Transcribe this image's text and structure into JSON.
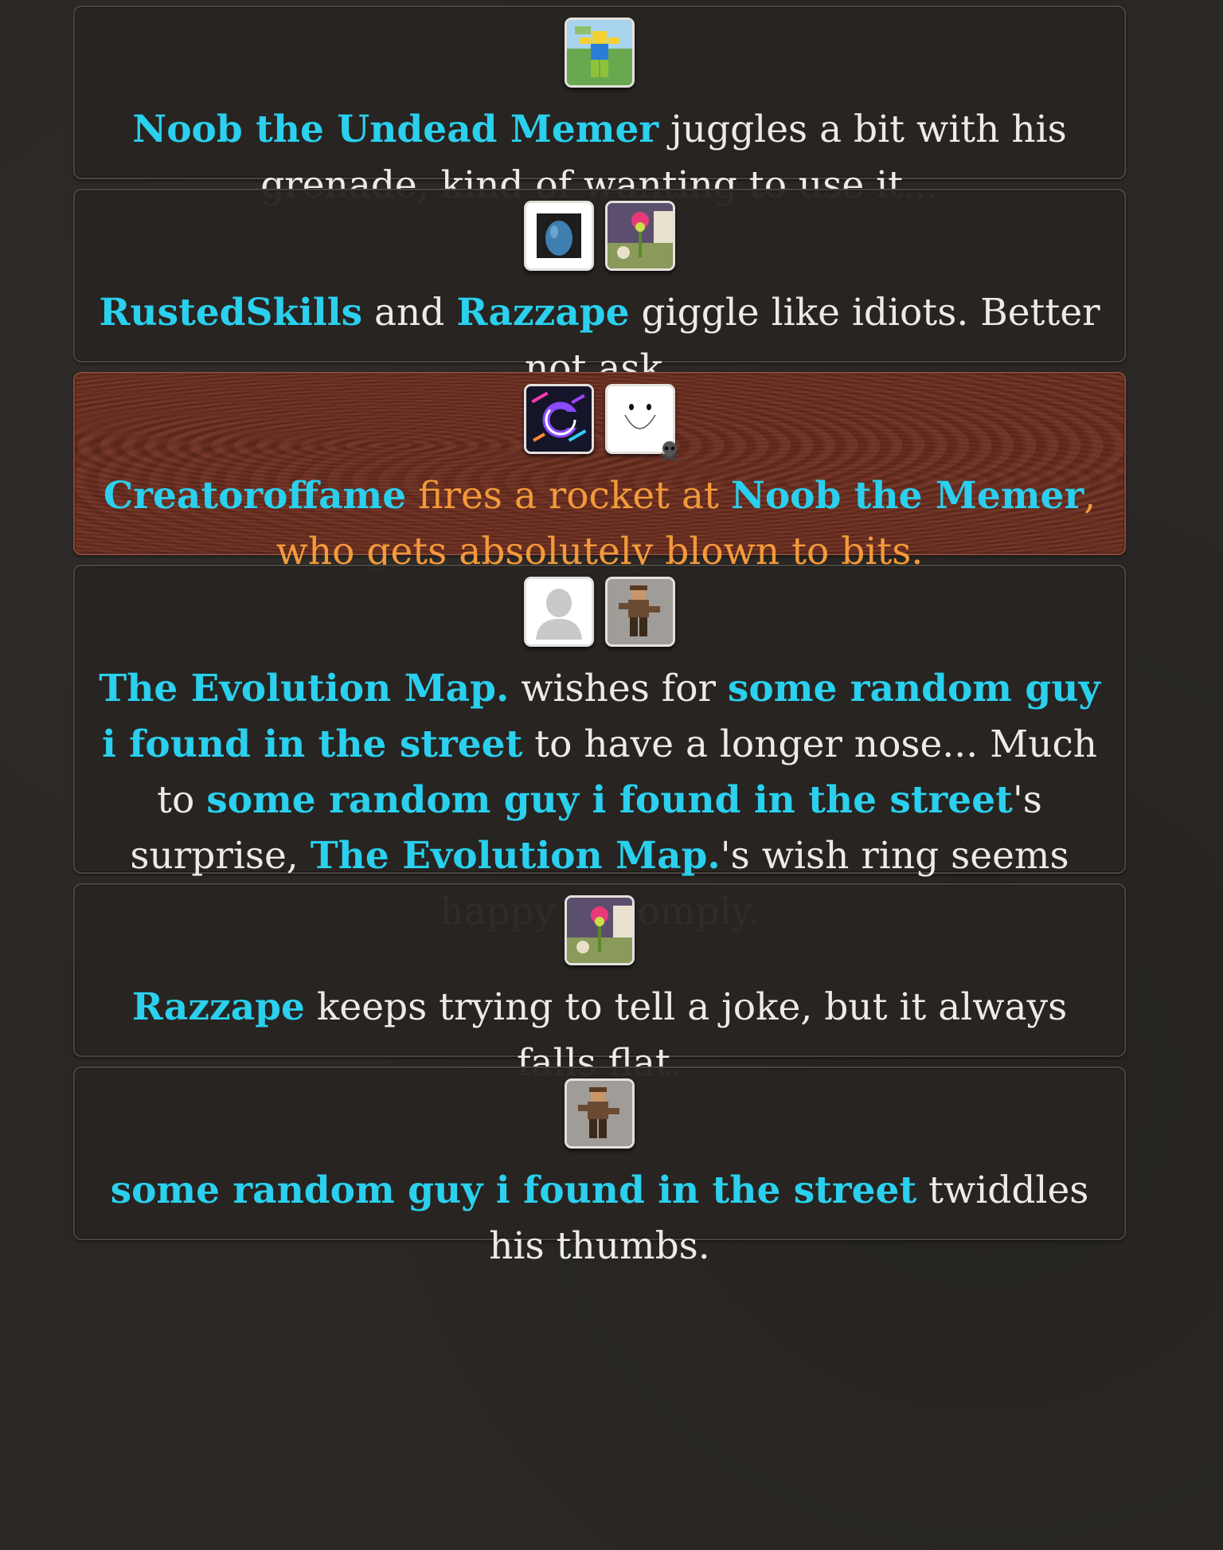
{
  "events": [
    {
      "avatars": [
        {
          "icon": "noob-avatar-icon"
        }
      ],
      "msg": {
        "p1": "Noob the Undead Memer",
        "p2": " juggles a bit with his grenade, kind of wanting to use it..."
      }
    },
    {
      "avatars": [
        {
          "icon": "blue-egg-avatar-icon"
        },
        {
          "icon": "flower-avatar-icon"
        }
      ],
      "msg": {
        "p1": "RustedSkills",
        "p2": " and ",
        "p3": "Razzape",
        "p4": " giggle like idiots. Better not ask."
      }
    },
    {
      "type": "fatal",
      "avatars": [
        {
          "icon": "creator-logo-avatar-icon"
        },
        {
          "icon": "smiley-face-avatar-icon",
          "badge": "skull-crossbones-icon"
        }
      ],
      "msg": {
        "p1": "Creatoroffame",
        "p2": " fires a rocket at ",
        "p3": "Noob the Memer",
        "p4": ", who gets absolutely blown to bits."
      }
    },
    {
      "avatars": [
        {
          "icon": "default-person-avatar-icon"
        },
        {
          "icon": "brown-character-avatar-icon"
        }
      ],
      "msg": {
        "p1": "The Evolution Map.",
        "p2": " wishes for ",
        "p3": "some random guy i found in the street",
        "p4": " to have a longer nose... Much to ",
        "p5": "some random guy i found in the street",
        "p6": "'s surprise, ",
        "p7": "The Evolution Map.",
        "p8": "'s wish ring seems happy to comply."
      }
    },
    {
      "avatars": [
        {
          "icon": "flower-avatar-icon"
        }
      ],
      "msg": {
        "p1": "Razzape",
        "p2": " keeps trying to tell a joke, but it always falls flat."
      }
    },
    {
      "avatars": [
        {
          "icon": "brown-character-avatar-icon"
        }
      ],
      "msg": {
        "p1": "some random guy i found in the street",
        "p2": " twiddles his thumbs."
      }
    }
  ],
  "colors": {
    "background": "#2a2724",
    "card": "#282421",
    "fatal_card": "#6e2e1f",
    "player_name": "#2ad0ee",
    "text": "#ecebe8",
    "fatal_text": "#f39a3a"
  }
}
